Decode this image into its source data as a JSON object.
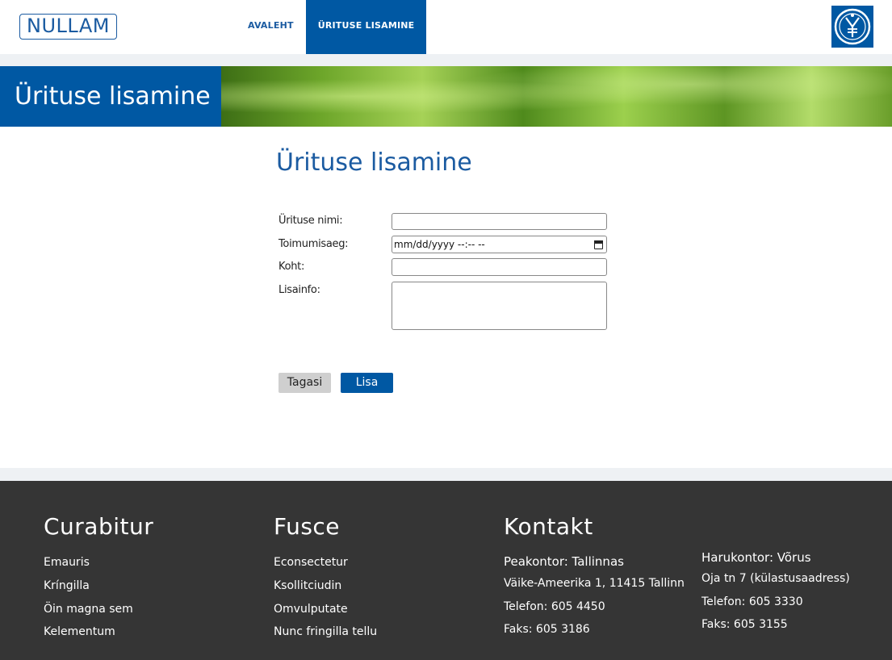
{
  "header": {
    "logo_text": "NULLAM",
    "nav": [
      {
        "label": "AVALEHT",
        "active": false
      },
      {
        "label": "ÜRITUSE LISAMINE",
        "active": true
      }
    ],
    "brand_icon": "emblem-icon"
  },
  "hero": {
    "title": "Ürituse lisamine",
    "image": "grass-banner-image"
  },
  "main": {
    "title": "Ürituse lisamine",
    "form": {
      "name_label": "Ürituse nimi:",
      "name_value": "",
      "datetime_label": "Toimumisaeg:",
      "datetime_placeholder": "mm/dd/yyyy --:-- --",
      "place_label": "Koht:",
      "place_value": "",
      "info_label": "Lisainfo:",
      "info_value": ""
    },
    "buttons": {
      "back": "Tagasi",
      "add": "Lisa"
    }
  },
  "footer": {
    "col1": {
      "heading": "Curabitur",
      "links": [
        "Emauris",
        "Kríngilla",
        "Öin magna sem",
        "Kelementum"
      ]
    },
    "col2": {
      "heading": "Fusce",
      "links": [
        "Econsectetur",
        "Ksollitciudin",
        "Omvulputate",
        "Nunc fringilla tellu"
      ]
    },
    "contact": {
      "heading": "Kontakt",
      "main": [
        "Peakontor: Tallinnas",
        "Väike-Ameerika 1, 11415 Tallinn",
        "Telefon: 605 4450",
        "Faks: 605 3186"
      ],
      "branch": [
        "Harukontor: Võrus",
        "Oja tn 7 (külastusaadress)",
        "Telefon: 605 3330",
        "Faks: 605 3155"
      ]
    }
  },
  "colors": {
    "primary": "#0058a3",
    "footer_bg": "#353535",
    "band_bg": "#eef1f4"
  }
}
